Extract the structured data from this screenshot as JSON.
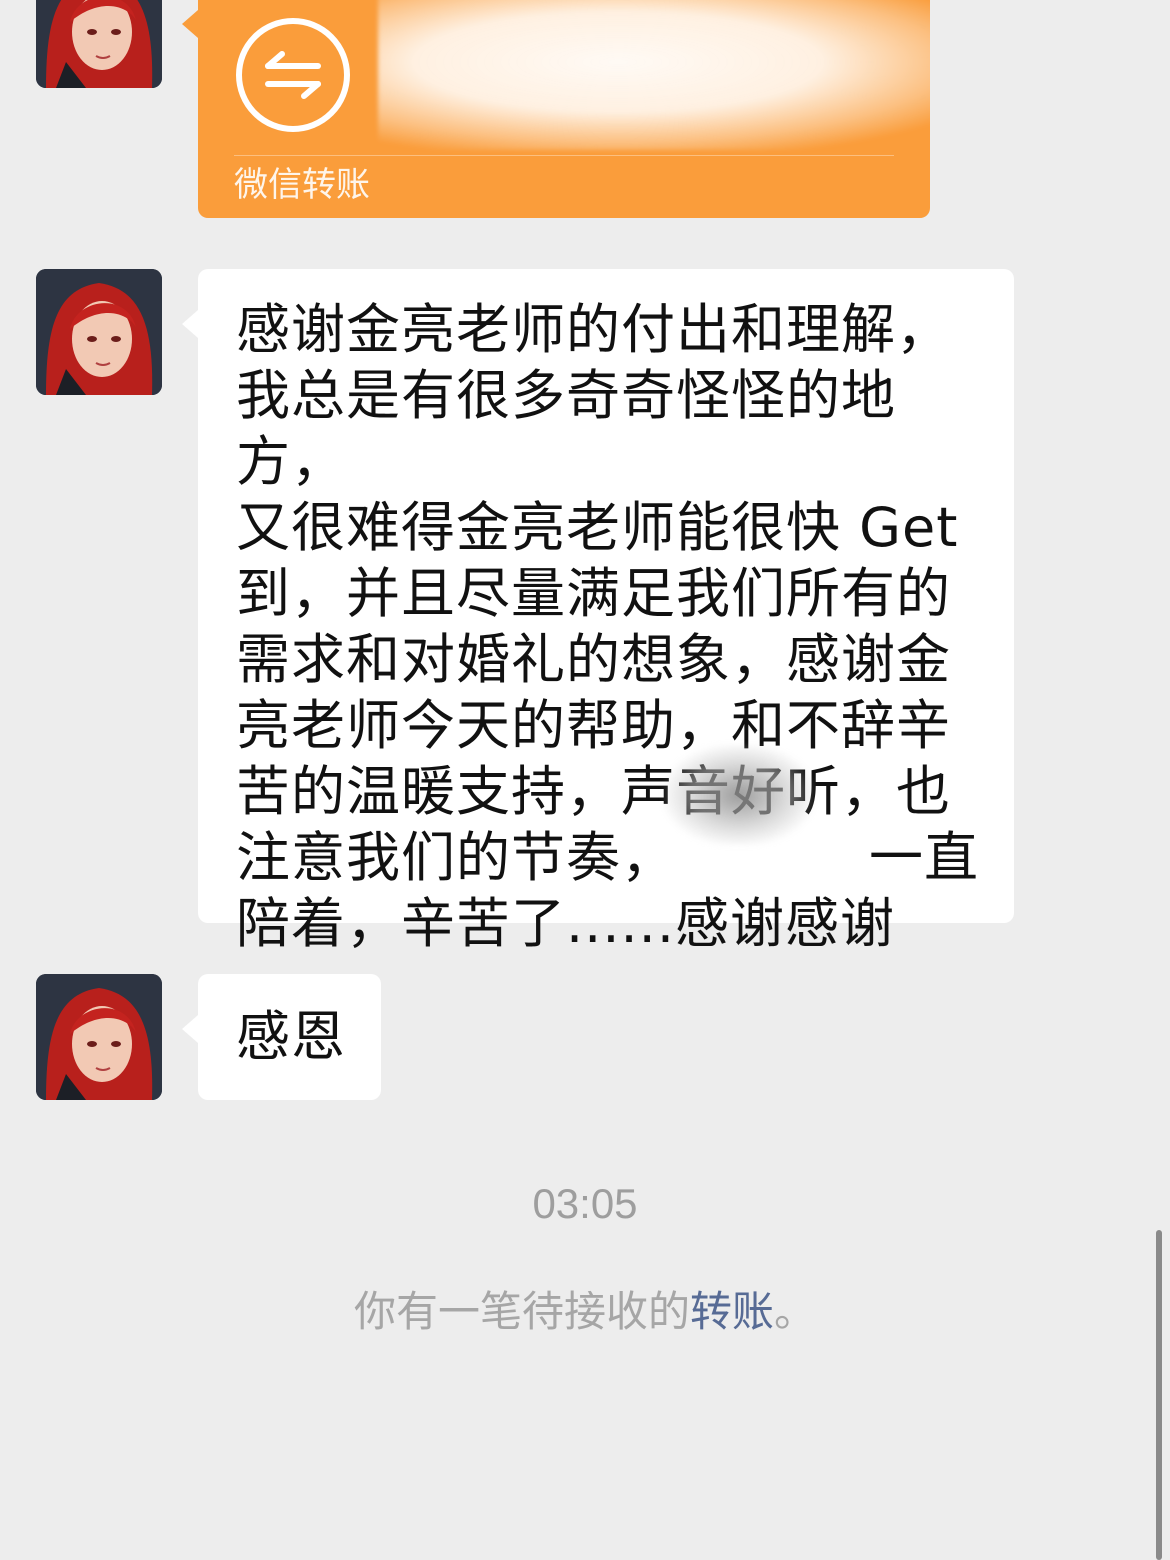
{
  "messages": [
    {
      "type": "transfer",
      "label": "微信转账"
    },
    {
      "type": "text",
      "text": "感谢金亮老师的付出和理解，\n我总是有很多奇奇怪怪的地方，\n又很难得金亮老师能很快 Get\n到，并且尽量满足我们所有的\n需求和对婚礼的想象，感谢金\n亮老师今天的帮助，和不辞辛\n苦的温暖支持，声音好听，也\n注意我们的节奏，　　　　一直\n陪着，辛苦了......感谢感谢"
    },
    {
      "type": "text",
      "text": "感恩"
    }
  ],
  "timestamp": "03:05",
  "system_notice": {
    "prefix": "你有一笔待接收的",
    "link": "转账",
    "suffix": "。"
  },
  "colors": {
    "background": "#ededed",
    "transfer_card": "#fa9d3b",
    "bubble": "#ffffff",
    "link": "#576b95"
  },
  "icons": {
    "transfer": "transfer-arrows-icon",
    "avatar": "user-avatar"
  }
}
